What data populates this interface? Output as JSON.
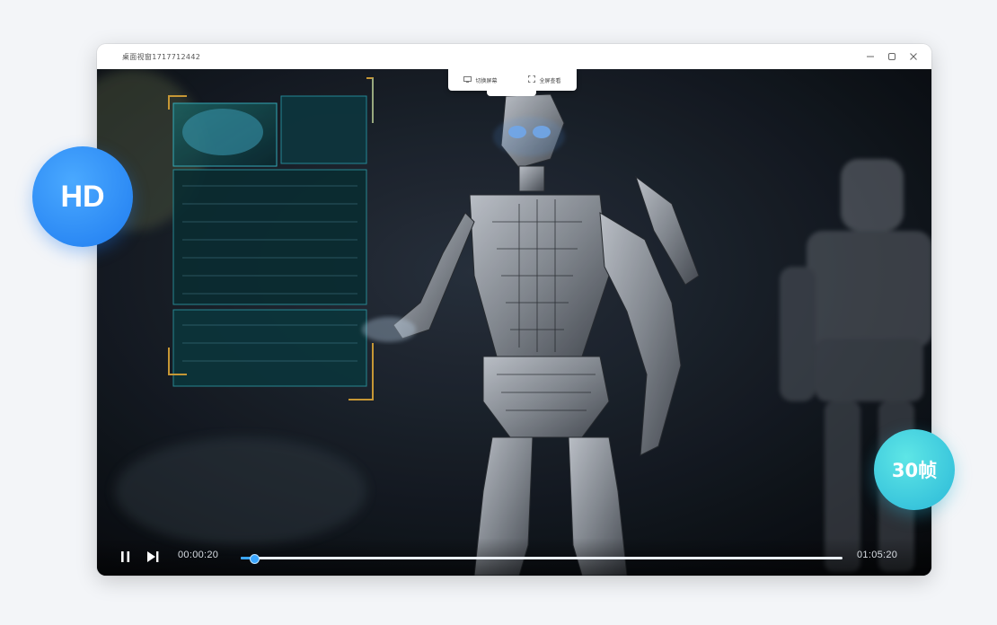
{
  "window": {
    "title": "桌面视窗1717712442",
    "controls": [
      "minimize-icon",
      "maximize-icon",
      "close-icon"
    ]
  },
  "top_menu": {
    "items": [
      {
        "label": "切换屏幕",
        "icon": "screen-switch-icon"
      },
      {
        "label": "全屏查看",
        "icon": "fullscreen-icon"
      }
    ]
  },
  "player": {
    "current_time": "00:00:20",
    "total_time": "01:05:20",
    "progress_fraction": 0.023,
    "state": "playing",
    "icons": [
      "pause-icon",
      "next-icon"
    ]
  },
  "badges": {
    "hd": "HD",
    "fps": "30帧"
  },
  "colors": {
    "accent_blue": "#3aa6ff",
    "hd_badge": "#2b8ff6",
    "fps_badge": "#3fcfe0"
  }
}
